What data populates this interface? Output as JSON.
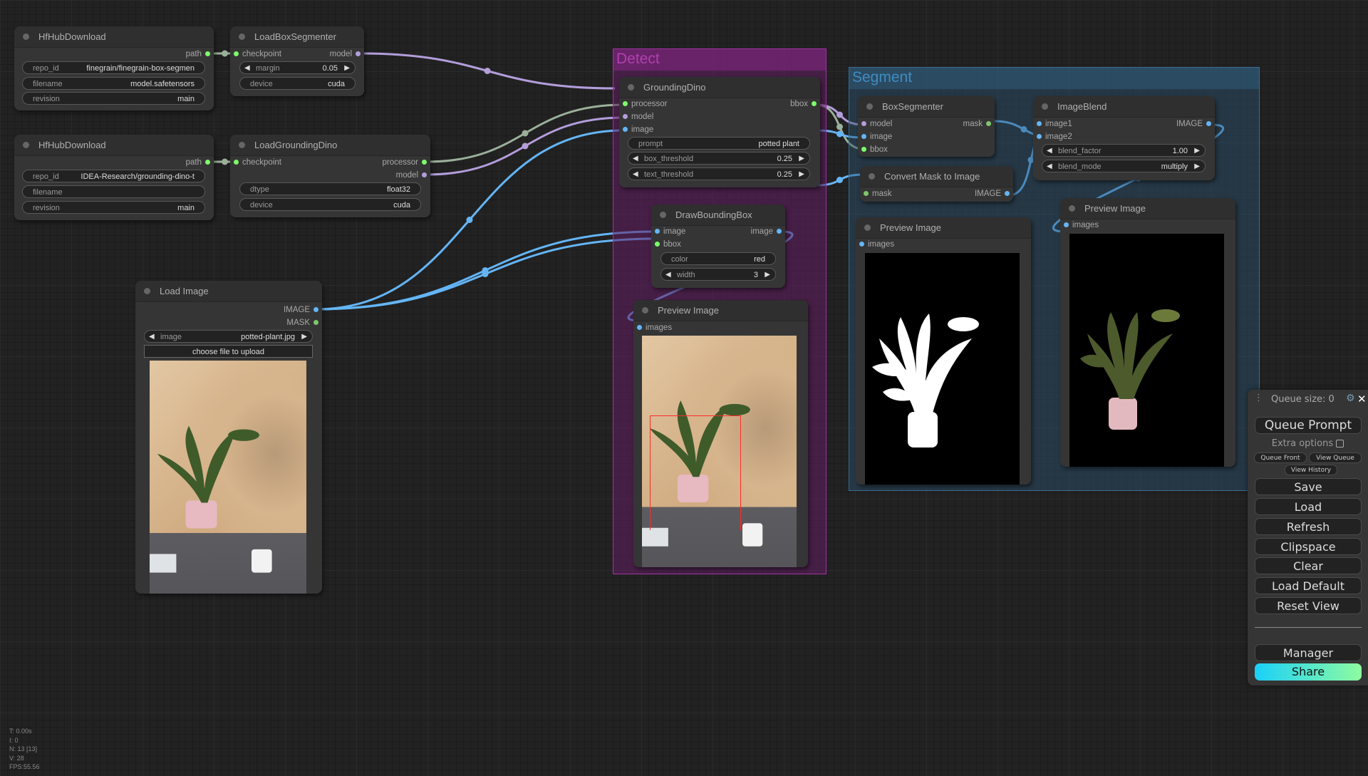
{
  "groups": {
    "detect": "Detect",
    "segment": "Segment"
  },
  "nodes": {
    "hf1": {
      "title": "HfHubDownload",
      "out": "path",
      "widgets": [
        {
          "label": "repo_id",
          "value": "finegrain/finegrain-box-segmen"
        },
        {
          "label": "filename",
          "value": "model.safetensors"
        },
        {
          "label": "revision",
          "value": "main"
        }
      ]
    },
    "hf2": {
      "title": "HfHubDownload",
      "out": "path",
      "widgets": [
        {
          "label": "repo_id",
          "value": "IDEA-Research/grounding-dino-t"
        },
        {
          "label": "filename",
          "value": ""
        },
        {
          "label": "revision",
          "value": "main"
        }
      ]
    },
    "lbs": {
      "title": "LoadBoxSegmenter",
      "in": "checkpoint",
      "out": "model",
      "widgets": [
        {
          "label": "margin",
          "value": "0.05"
        },
        {
          "label": "device",
          "value": "cuda"
        }
      ]
    },
    "lgd": {
      "title": "LoadGroundingDino",
      "in": "checkpoint",
      "outs": [
        "processor",
        "model"
      ],
      "widgets": [
        {
          "label": "dtype",
          "value": "float32"
        },
        {
          "label": "device",
          "value": "cuda"
        }
      ]
    },
    "load": {
      "title": "Load Image",
      "outs": [
        "IMAGE",
        "MASK"
      ],
      "widgets": [
        {
          "label": "image",
          "value": "potted-plant.jpg"
        }
      ],
      "upload": "choose file to upload"
    },
    "gd": {
      "title": "GroundingDino",
      "ins": [
        "processor",
        "model",
        "image"
      ],
      "out": "bbox",
      "widgets": [
        {
          "label": "prompt",
          "value": "potted plant"
        },
        {
          "label": "box_threshold",
          "value": "0.25"
        },
        {
          "label": "text_threshold",
          "value": "0.25"
        }
      ]
    },
    "dbb": {
      "title": "DrawBoundingBox",
      "ins": [
        "image",
        "bbox"
      ],
      "out": "image",
      "widgets": [
        {
          "label": "color",
          "value": "red"
        },
        {
          "label": "width",
          "value": "3"
        }
      ]
    },
    "pv1": {
      "title": "Preview Image",
      "in": "images"
    },
    "bs": {
      "title": "BoxSegmenter",
      "ins": [
        "model",
        "image",
        "bbox"
      ],
      "out": "mask"
    },
    "cm": {
      "title": "Convert Mask to Image",
      "in": "mask",
      "out": "IMAGE"
    },
    "ib": {
      "title": "ImageBlend",
      "ins": [
        "image1",
        "image2"
      ],
      "out": "IMAGE",
      "widgets": [
        {
          "label": "blend_factor",
          "value": "1.00"
        },
        {
          "label": "blend_mode",
          "value": "multiply"
        }
      ]
    },
    "pv2": {
      "title": "Preview Image",
      "in": "images"
    },
    "pv3": {
      "title": "Preview Image",
      "in": "images"
    }
  },
  "queue": {
    "size_label": "Queue size: 0",
    "queue_prompt": "Queue Prompt",
    "extra_options": "Extra options",
    "queue_front": "Queue Front",
    "view_queue": "View Queue",
    "view_history": "View History",
    "buttons": [
      "Save",
      "Load",
      "Refresh",
      "Clipspace",
      "Clear",
      "Load Default",
      "Reset View"
    ],
    "manager": "Manager",
    "share": "Share"
  },
  "stats": [
    "T: 0.00s",
    "I: 0",
    "N: 13 [13]",
    "V: 28",
    "FPS:55.56"
  ],
  "colors": {
    "image": "#64b5f6",
    "model": "#b39ddb",
    "green": "#7cfc6b",
    "bbox_red": "#ff2a2a",
    "share_start": "#1ad0f8",
    "share_end": "#8efca0"
  }
}
